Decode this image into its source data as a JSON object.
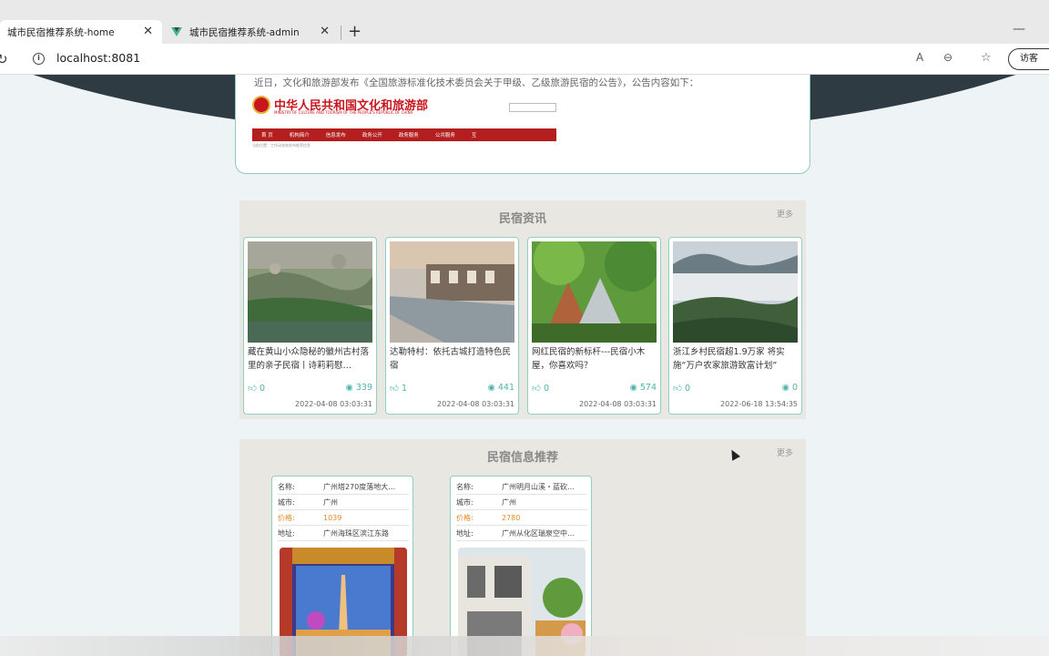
{
  "browser": {
    "tabs": [
      {
        "title": "城市民宿推荐系统-home",
        "active": true
      },
      {
        "title": "城市民宿推荐系统-admin",
        "active": false
      }
    ],
    "url": "localhost:8081",
    "visitor_label": "访客"
  },
  "notice": {
    "text": "近日，文化和旅游部发布《全国旅游标准化技术委员会关于甲级、乙级旅游民宿的公告》，公告内容如下：",
    "ministry_title": "中华人民共和国文化和旅游部",
    "ministry_subtitle": "MINISTRY OF CULTURE AND TOURISM OF THE PEOPLE'S REPUBLIC OF CHINA",
    "nav": [
      "首 页",
      "机构简介",
      "信息发布",
      "政务公开",
      "政务服务",
      "公共服务",
      "互"
    ],
    "breadcrumb": "当前位置：工作动态和发布推荐信息"
  },
  "news": {
    "title": "民宿资讯",
    "more": "更多",
    "items": [
      {
        "title": "藏在黄山小众隐秘的徽州古村落里的亲子民宿丨诗莉莉慰…",
        "likes": "0",
        "views": "339",
        "date": "2022-04-08 03:03:31"
      },
      {
        "title": "达勒特村：依托古城打造特色民宿",
        "likes": "1",
        "views": "441",
        "date": "2022-04-08 03:03:31"
      },
      {
        "title": "网红民宿的新标杆---民宿小木屋，你喜欢吗？",
        "likes": "0",
        "views": "574",
        "date": "2022-04-08 03:03:31"
      },
      {
        "title": "浙江乡村民宿超1.9万家 将实施“万户农家旅游致富计划”",
        "likes": "0",
        "views": "0",
        "date": "2022-06-18 13:54:35"
      }
    ]
  },
  "recommend": {
    "title": "民宿信息推荐",
    "more": "更多",
    "labels": {
      "name": "名称:",
      "city": "城市:",
      "price": "价格:",
      "address": "地址:"
    },
    "items": [
      {
        "name": "广州塔270度落地大…",
        "city": "广州",
        "price": "1039",
        "address": "广州海珠区滨江东路"
      },
      {
        "name": "广州明月山溪・蓝砍…",
        "city": "广州",
        "price": "2780",
        "address": "广州从化区瑞泉空中…"
      }
    ]
  },
  "colors": {
    "accent": "#4fb3a8",
    "price": "#e08a2a",
    "dark_band": "#2f3b42"
  }
}
